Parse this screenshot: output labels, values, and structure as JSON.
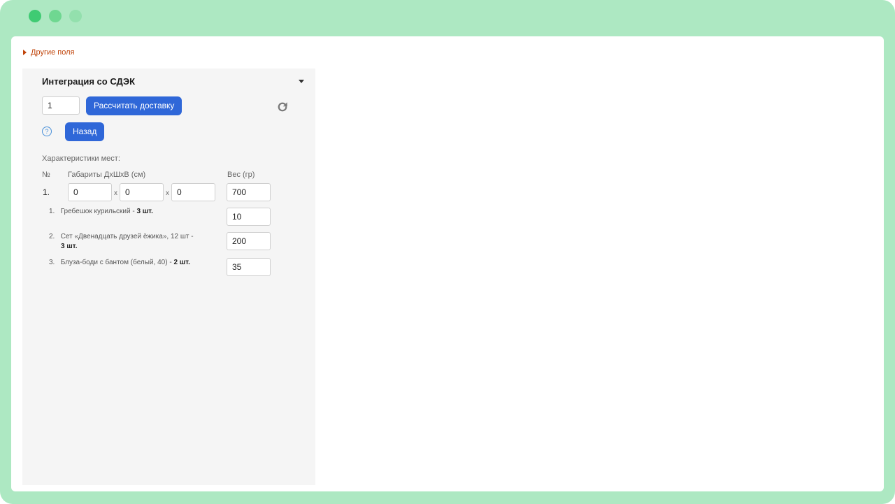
{
  "other_fields": {
    "label": "Другие поля"
  },
  "integration": {
    "title": "Интеграция со СДЭК",
    "places_count": "1",
    "calc_button": "Рассчитать доставку",
    "help": "?",
    "back_button": "Назад",
    "characteristics_label": "Характеристики мест:",
    "headers": {
      "number": "№",
      "dimensions": "Габариты ДхШхВ (см)",
      "weight": "Вес (гр)"
    },
    "place": {
      "number": "1.",
      "length": "0",
      "width": "0",
      "height": "0",
      "weight": "700",
      "x_sep": "x"
    },
    "items": [
      {
        "num": "1.",
        "name_line1": "Гребешок курильский - ",
        "qty": "3 шт.",
        "name_line2": "",
        "weight": "10"
      },
      {
        "num": "2.",
        "name_line1": "Сет «Двенадцать друзей ёжика», 12 шт -",
        "name_line2": "",
        "qty": "3 шт.",
        "weight": "200"
      },
      {
        "num": "3.",
        "name_line1": "Блуза-боди с бантом (белый, 40) - ",
        "qty": "2 шт.",
        "name_line2": "",
        "weight": "35"
      }
    ]
  },
  "colors": {
    "accent": "#2f67d8",
    "link": "#c0440a",
    "frame": "#ade8c2"
  }
}
